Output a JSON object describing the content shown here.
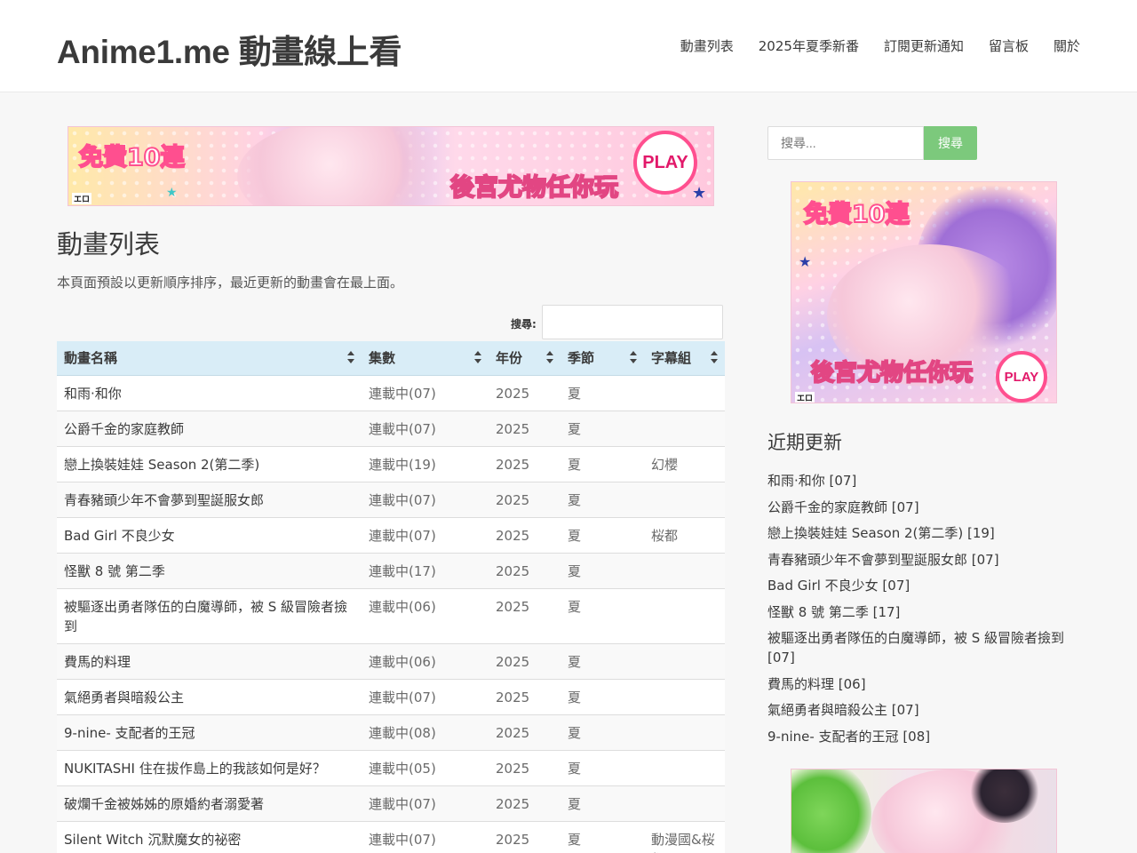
{
  "header": {
    "site_title": "Anime1.me 動畫線上看",
    "nav": [
      "動畫列表",
      "2025年夏季新番",
      "訂閱更新通知",
      "留言板",
      "關於"
    ]
  },
  "ad": {
    "headline": "免費10連",
    "tagline": "後宮尤物任你玩",
    "play": "PLAY",
    "logo": "エロ"
  },
  "main": {
    "title": "動畫列表",
    "intro": "本頁面預設以更新順序排序，最近更新的動畫會在最上面。",
    "search_label": "搜尋:",
    "columns": [
      "動畫名稱",
      "集數",
      "年份",
      "季節",
      "字幕組"
    ],
    "rows": [
      [
        "和雨·和你",
        "連載中(07)",
        "2025",
        "夏",
        ""
      ],
      [
        "公爵千金的家庭教師",
        "連載中(07)",
        "2025",
        "夏",
        ""
      ],
      [
        "戀上換裝娃娃 Season 2(第二季)",
        "連載中(19)",
        "2025",
        "夏",
        "幻櫻"
      ],
      [
        "青春豬頭少年不會夢到聖誕服女郎",
        "連載中(07)",
        "2025",
        "夏",
        ""
      ],
      [
        "Bad Girl 不良少女",
        "連載中(07)",
        "2025",
        "夏",
        "桜都"
      ],
      [
        "怪獸 8 號 第二季",
        "連載中(17)",
        "2025",
        "夏",
        ""
      ],
      [
        "被驅逐出勇者隊伍的白魔導師，被 S 級冒險者撿到",
        "連載中(06)",
        "2025",
        "夏",
        ""
      ],
      [
        "費馬的料理",
        "連載中(06)",
        "2025",
        "夏",
        ""
      ],
      [
        "氣絕勇者與暗殺公主",
        "連載中(07)",
        "2025",
        "夏",
        ""
      ],
      [
        "9-nine- 支配者的王冠",
        "連載中(08)",
        "2025",
        "夏",
        ""
      ],
      [
        "NUKITASHI 住在拔作島上的我該如何是好？",
        "連載中(05)",
        "2025",
        "夏",
        ""
      ],
      [
        "破爛千金被姊姊的原婚約者溺愛著",
        "連載中(07)",
        "2025",
        "夏",
        ""
      ],
      [
        "Silent Witch 沉默魔女的祕密",
        "連載中(07)",
        "2025",
        "夏",
        "動漫國&桜都"
      ]
    ]
  },
  "sidebar": {
    "search_placeholder": "搜尋...",
    "search_button": "搜尋",
    "recent_title": "近期更新",
    "recent": [
      "和雨·和你 [07]",
      "公爵千金的家庭教師 [07]",
      "戀上換裝娃娃 Season 2(第二季) [19]",
      "青春豬頭少年不會夢到聖誕服女郎 [07]",
      "Bad Girl 不良少女 [07]",
      "怪獸 8 號 第二季 [17]",
      "被驅逐出勇者隊伍的白魔導師，被 S 級冒險者撿到 [07]",
      "費馬的料理 [06]",
      "氣絕勇者與暗殺公主 [07]",
      "9-nine- 支配者的王冠 [08]"
    ]
  },
  "colors": {
    "table_header_bg": "#d9edf7",
    "search_button_bg": "#7cc97c",
    "accent_pink": "#ff4f8f"
  }
}
